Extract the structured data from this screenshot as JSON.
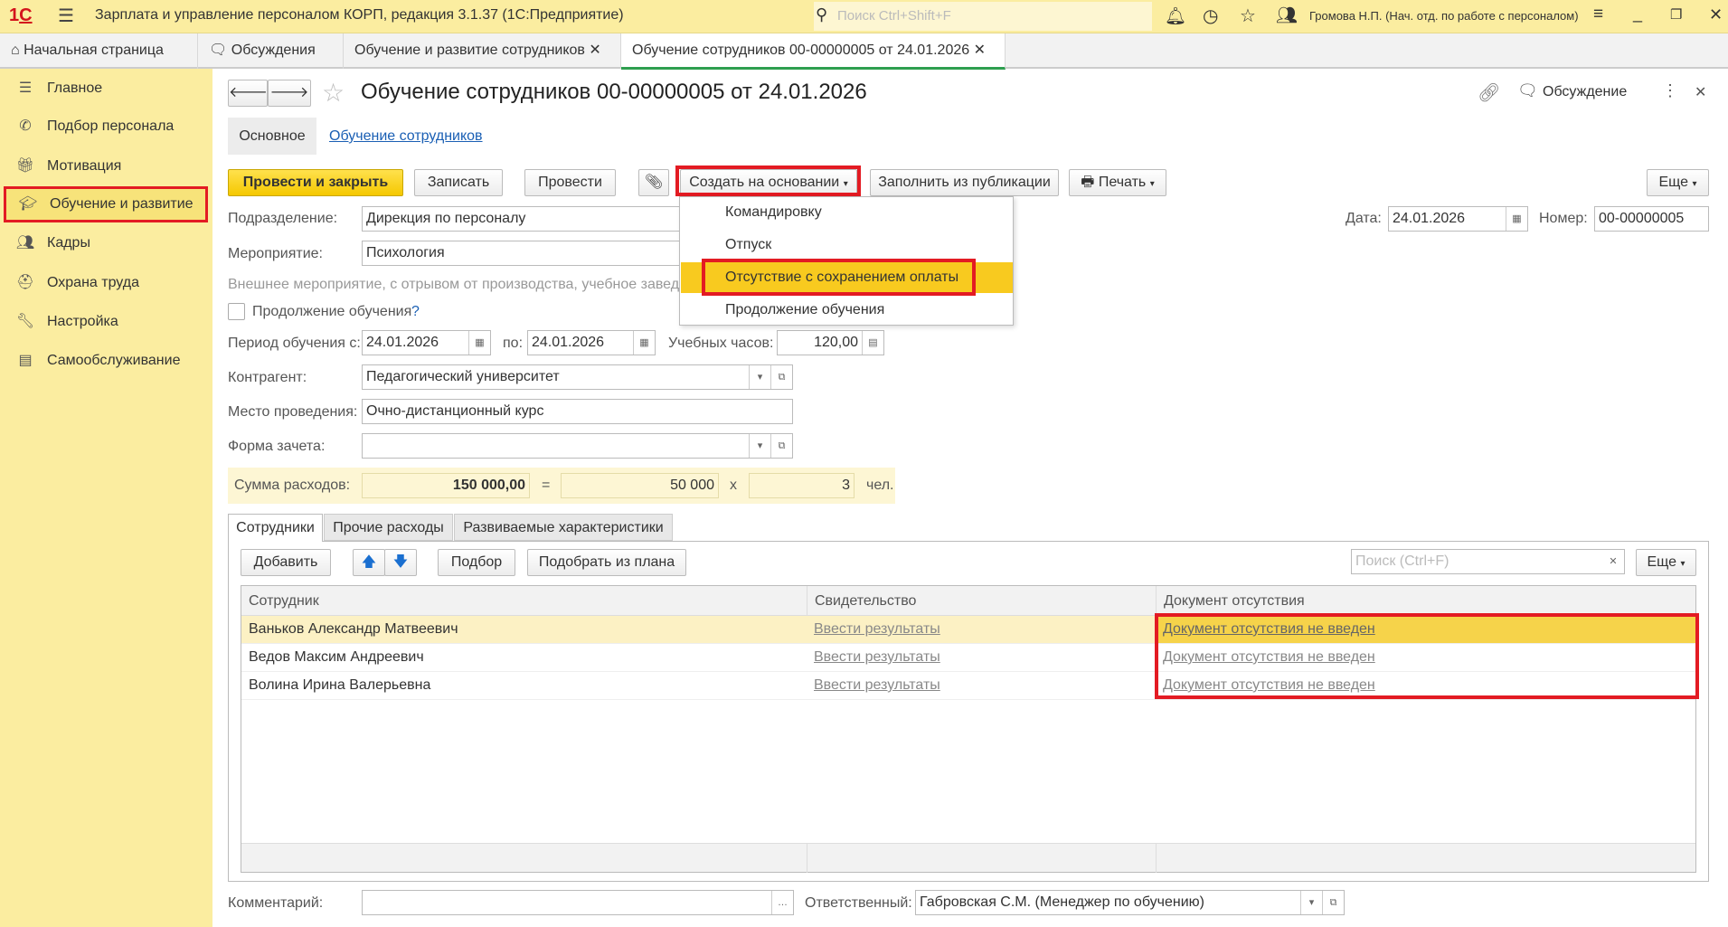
{
  "titlebar": {
    "app_title": "Зарплата и управление персоналом КОРП, редакция 3.1.37  (1С:Предприятие)",
    "search_placeholder": "Поиск Ctrl+Shift+F",
    "user": "Громова Н.П. (Нач. отд. по работе с персоналом)",
    "logo": "1С"
  },
  "tabs": [
    "Начальная страница",
    "Обсуждения",
    "Обучение и развитие сотрудников",
    "Обучение сотрудников 00-00000005 от 24.01.2026"
  ],
  "sidebar": [
    "Главное",
    "Подбор персонала",
    "Мотивация",
    "Обучение и развитие",
    "Кадры",
    "Охрана труда",
    "Настройка",
    "Самообслуживание"
  ],
  "doc": {
    "title": "Обучение сотрудников 00-00000005 от 24.01.2026",
    "discussion": "Обсуждение",
    "section_main": "Основное",
    "section_link": "Обучение сотрудников"
  },
  "toolbar": {
    "post_close": "Провести и закрыть",
    "save": "Записать",
    "post": "Провести",
    "create_based": "Создать на основании",
    "fill": "Заполнить из публикации",
    "print": "Печать",
    "more": "Еще"
  },
  "menu": [
    "Командировку",
    "Отпуск",
    "Отсутствие с сохранением оплаты",
    "Продолжение обучения"
  ],
  "form": {
    "dept_label": "Подразделение:",
    "dept": "Дирекция по персоналу",
    "event_label": "Мероприятие:",
    "event": "Психология",
    "event_desc": "Внешнее мероприятие, с отрывом от производства, учебное заведе",
    "continue_label": "Продолжение обучения",
    "help": "?",
    "period_label": "Период обучения с:",
    "from": "24.01.2026",
    "to_label": "по:",
    "to": "24.01.2026",
    "hours_label": "Учебных часов:",
    "hours": "120,00",
    "contractor_label": "Контрагент:",
    "contractor": "Педагогический университет",
    "place_label": "Место проведения:",
    "place": "Очно-дистанционный курс",
    "form_label": "Форма зачета:",
    "form": "",
    "cost_label": "Сумма расходов:",
    "cost": "150 000,00",
    "eq": "=",
    "per": "50 000",
    "x": "x",
    "count": "3",
    "unit": "чел.",
    "date_label": "Дата:",
    "date": "24.01.2026",
    "number_label": "Номер:",
    "number": "00-00000005"
  },
  "inner_tabs": [
    "Сотрудники",
    "Прочие расходы",
    "Развиваемые характеристики"
  ],
  "table_toolbar": {
    "add": "Добавить",
    "pick": "Подбор",
    "pick_plan": "Подобрать из плана",
    "search_placeholder": "Поиск (Ctrl+F)",
    "more": "Еще"
  },
  "table": {
    "headers": [
      "Сотрудник",
      "Свидетельство",
      "Документ отсутствия"
    ],
    "rows": [
      [
        "Ваньков Александр Матвеевич",
        "Ввести результаты",
        "Документ отсутствия не введен"
      ],
      [
        "Ведов Максим Андреевич",
        "Ввести результаты",
        "Документ отсутствия не введен"
      ],
      [
        "Волина Ирина Валерьевна",
        "Ввести результаты",
        "Документ отсутствия не введен"
      ]
    ]
  },
  "footer": {
    "comment_label": "Комментарий:",
    "comment": "",
    "responsible_label": "Ответственный:",
    "responsible": "Габровская С.М. (Менеджер по обучению)"
  }
}
